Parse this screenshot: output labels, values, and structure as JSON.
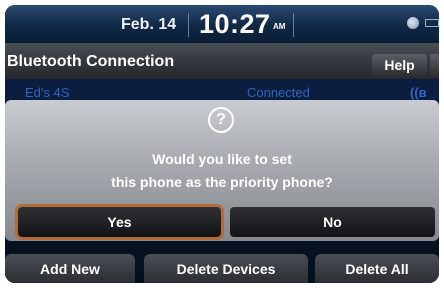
{
  "status_bar": {
    "date": "Feb. 14",
    "time": "10:27",
    "ampm": "AM"
  },
  "header": {
    "title": "Bluetooth Connection",
    "help_label": "Help"
  },
  "device_list": [
    {
      "name": "Ed's 4S",
      "status": "Connected",
      "icon": "bluetooth-icon"
    }
  ],
  "dialog": {
    "icon": "question-icon",
    "message_line1": "Would you like to set",
    "message_line2": "this phone as the priority phone?",
    "yes_label": "Yes",
    "no_label": "No"
  },
  "footer": {
    "add_new_label": "Add New",
    "delete_devices_label": "Delete Devices",
    "delete_all_label": "Delete All"
  },
  "colors": {
    "highlight": "#b36b38",
    "list_text": "#2f67bd"
  }
}
